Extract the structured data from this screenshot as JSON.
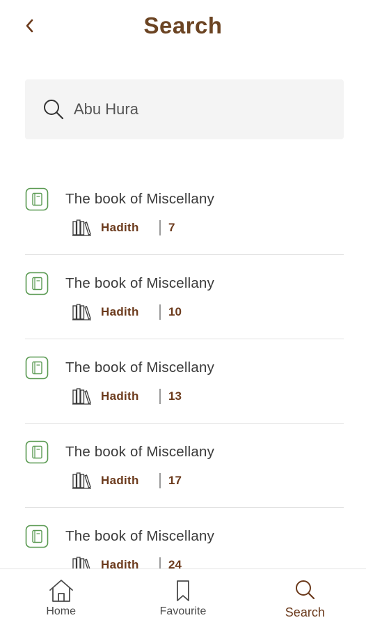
{
  "header": {
    "title": "Search"
  },
  "search": {
    "value": "Abu Hura"
  },
  "results": [
    {
      "title": "The book of Miscellany",
      "type": "Hadith",
      "number": "7"
    },
    {
      "title": "The book of Miscellany",
      "type": "Hadith",
      "number": "10"
    },
    {
      "title": "The book of Miscellany",
      "type": "Hadith",
      "number": "13"
    },
    {
      "title": "The book of Miscellany",
      "type": "Hadith",
      "number": "17"
    },
    {
      "title": "The book of Miscellany",
      "type": "Hadith",
      "number": "24"
    }
  ],
  "nav": {
    "home": "Home",
    "favourite": "Favourite",
    "search": "Search",
    "active": "search"
  },
  "colors": {
    "accent_brown": "#6b3a1c",
    "title_brown": "#6b4423",
    "icon_green": "#4f8a4a",
    "search_bg": "#f4f4f4"
  },
  "icons": {
    "back": "chevron-left-icon",
    "search": "search-icon",
    "item": "book-icon",
    "meta": "books-icon",
    "home": "home-icon",
    "favourite": "bookmark-icon"
  }
}
